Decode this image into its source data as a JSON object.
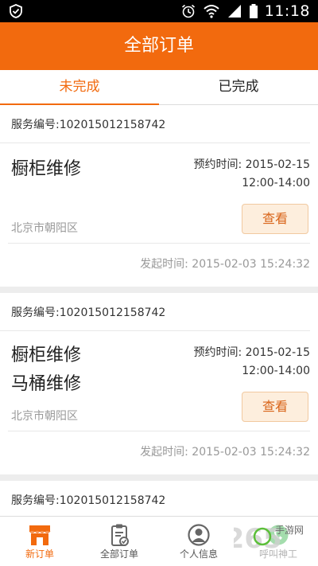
{
  "status_bar": {
    "time": "11:18"
  },
  "header": {
    "title": "全部订单"
  },
  "tabs": [
    {
      "label": "未完成",
      "active": true
    },
    {
      "label": "已完成",
      "active": false
    }
  ],
  "orders": [
    {
      "order_id": "服务编号:102015012158742",
      "services": [
        "橱柜维修"
      ],
      "appointment_label": "预约时间: 2015-02-15",
      "appointment_time": "12:00-14:00",
      "address": "北京市朝阳区",
      "view_label": "查看",
      "created": "发起时间: 2015-02-03 15:24:32"
    },
    {
      "order_id": "服务编号:102015012158742",
      "services": [
        "橱柜维修",
        "马桶维修"
      ],
      "appointment_label": "预约时间: 2015-02-15",
      "appointment_time": "12:00-14:00",
      "address": "北京市朝阳区",
      "view_label": "查看",
      "created": "发起时间: 2015-02-03 15:24:32"
    },
    {
      "order_id": "服务编号:102015012158742"
    }
  ],
  "bottom_nav": [
    {
      "label": "新订单",
      "icon": "store-icon",
      "active": true
    },
    {
      "label": "全部订单",
      "icon": "clipboard-check-icon",
      "active": false
    },
    {
      "label": "个人信息",
      "icon": "person-icon",
      "active": false
    },
    {
      "label": "呼叫神工",
      "icon": "phone-icon",
      "active": false
    }
  ],
  "watermark": {
    "text": "2265",
    "sub": "手游网"
  },
  "colors": {
    "accent": "#f26a0e",
    "button_bg": "#fdeedd",
    "muted": "#999999"
  }
}
